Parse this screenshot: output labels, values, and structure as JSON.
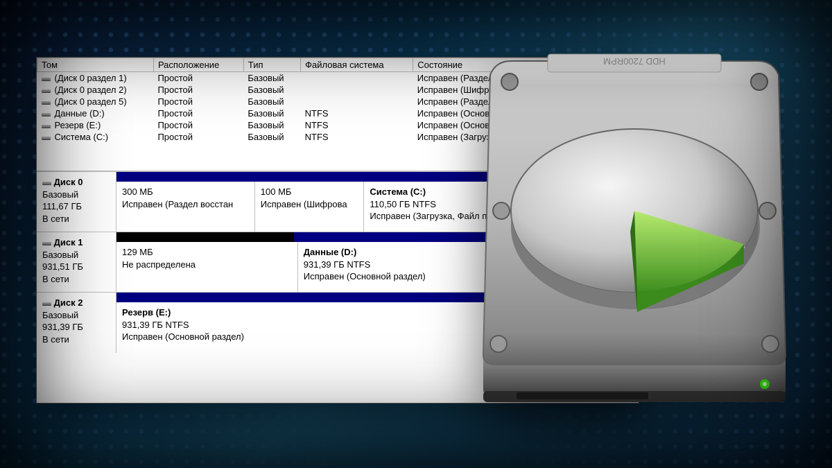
{
  "columns": {
    "c0": "Том",
    "c1": "Расположение",
    "c2": "Тип",
    "c3": "Файловая система",
    "c4": "Состояние"
  },
  "volumes": [
    {
      "name": "(Диск 0 раздел 1)",
      "layout": "Простой",
      "type": "Базовый",
      "fs": "",
      "status": "Исправен (Раздел восстановления)"
    },
    {
      "name": "(Диск 0 раздел 2)",
      "layout": "Простой",
      "type": "Базовый",
      "fs": "",
      "status": "Исправен (Шифрованный (EFI) системн"
    },
    {
      "name": "(Диск 0 раздел 5)",
      "layout": "Простой",
      "type": "Базовый",
      "fs": "",
      "status": "Исправен (Раздел восстановления)"
    },
    {
      "name": "Данные (D:)",
      "layout": "Простой",
      "type": "Базовый",
      "fs": "NTFS",
      "status": "Исправен (Основной раздел)"
    },
    {
      "name": "Резерв (E:)",
      "layout": "Простой",
      "type": "Базовый",
      "fs": "NTFS",
      "status": "Исправен (Основной раздел)"
    },
    {
      "name": "Система (C:)",
      "layout": "Простой",
      "type": "Базовый",
      "fs": "NTFS",
      "status": "Исправен (Загрузка, Файл подкачки, А"
    }
  ],
  "disks": [
    {
      "name": "Диск 0",
      "type": "Базовый",
      "size": "111,67 ГБ",
      "online": "В сети",
      "bar": [
        {
          "color": "#000080",
          "flex": 1
        }
      ],
      "parts": [
        {
          "flex": 26,
          "title": "",
          "line2": "300 МБ",
          "line3": "Исправен (Раздел восстан"
        },
        {
          "flex": 20,
          "title": "",
          "line2": "100 МБ",
          "line3": "Исправен (Шифрова"
        },
        {
          "flex": 54,
          "title": "Система  (C:)",
          "line2": "110,50 ГБ NTFS",
          "line3": "Исправен (Загрузка, Файл подкач"
        }
      ]
    },
    {
      "name": "Диск 1",
      "type": "Базовый",
      "size": "931,51 ГБ",
      "online": "В сети",
      "bar": [
        {
          "color": "#000",
          "flex": 34
        },
        {
          "color": "#000080",
          "flex": 66
        }
      ],
      "parts": [
        {
          "flex": 34,
          "title": "",
          "line2": "129 МБ",
          "line3": "Не распределена"
        },
        {
          "flex": 66,
          "title": "Данные  (D:)",
          "line2": "931,39 ГБ NTFS",
          "line3": "Исправен (Основной раздел)"
        }
      ]
    },
    {
      "name": "Диск 2",
      "type": "Базовый",
      "size": "931,39 ГБ",
      "online": "В сети",
      "bar": [
        {
          "color": "#000080",
          "flex": 1
        }
      ],
      "parts": [
        {
          "flex": 100,
          "title": "Резерв  (E:)",
          "line2": "931,39 ГБ NTFS",
          "line3": "Исправен (Основной раздел)"
        }
      ]
    }
  ],
  "hdd_label": "HDD 7200RPM"
}
